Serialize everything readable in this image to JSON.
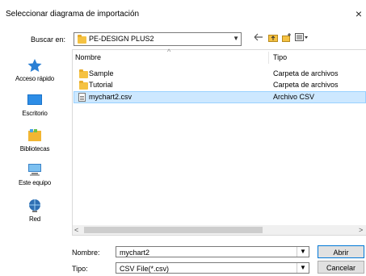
{
  "dialog": {
    "title": "Seleccionar diagrama de importación",
    "close_glyph": "×"
  },
  "lookin": {
    "label": "Buscar en:",
    "folder": "PE-DESIGN PLUS2",
    "icons": [
      "back-arrow-icon",
      "up-folder-icon",
      "new-folder-icon",
      "view-menu-icon"
    ]
  },
  "places": [
    {
      "label": "Acceso rápido",
      "icon": "star-icon",
      "color": "#2a7fd4"
    },
    {
      "label": "Escritorio",
      "icon": "desktop-icon",
      "color": "#1a73c9"
    },
    {
      "label": "Bibliotecas",
      "icon": "libraries-icon",
      "color": "#f2b632"
    },
    {
      "label": "Este equipo",
      "icon": "computer-icon",
      "color": "#3b84c8"
    },
    {
      "label": "Red",
      "icon": "network-icon",
      "color": "#2e6fb3"
    }
  ],
  "list": {
    "columns": {
      "name": "Nombre",
      "type": "Tipo"
    },
    "rows": [
      {
        "name": "Sample",
        "type": "Carpeta de archivos",
        "kind": "folder",
        "selected": false
      },
      {
        "name": "Tutorial",
        "type": "Carpeta de archivos",
        "kind": "folder",
        "selected": false
      },
      {
        "name": "mychart2.csv",
        "type": "Archivo CSV",
        "kind": "file",
        "selected": true
      }
    ]
  },
  "footer": {
    "name_label": "Nombre:",
    "name_value": "mychart2",
    "type_label": "Tipo:",
    "type_value": "CSV File(*.csv)",
    "open_label": "Abrir",
    "cancel_label": "Cancelar"
  },
  "colors": {
    "selection": "#cde8ff",
    "selection_border": "#99d1ff",
    "folder": "#f5c242",
    "accent": "#0078d7"
  }
}
